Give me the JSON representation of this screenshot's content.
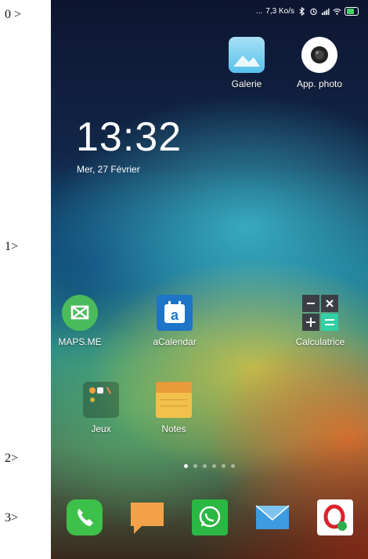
{
  "margin_labels": [
    "0 >",
    "1>",
    "2>",
    "3>"
  ],
  "status": {
    "speed": "7,3 Ko/s",
    "menu": "..."
  },
  "lockscreen": {
    "time": "13:32",
    "date": "Mer, 27 Février"
  },
  "apps": {
    "galerie": "Galerie",
    "camera": "App. photo",
    "maps": "MAPS.ME",
    "acalendar": "aCalendar",
    "calculatrice": "Calculatrice",
    "jeux": "Jeux",
    "notes": "Notes"
  },
  "dock": [
    "phone-icon",
    "messages-icon",
    "whatsapp-icon",
    "email-icon",
    "opera-icon"
  ],
  "pager": {
    "pages": 6,
    "active": 1
  },
  "colors": {
    "maps": "#4cbb5c",
    "acalendar": "#1e74c6",
    "calc": "#3b3f45",
    "notes": "#f2c14b",
    "phone": "#3ec14a",
    "message": "#f4a24a",
    "whatsapp": "#2bb743",
    "mail": "#3d9be0",
    "opera": "#d8232a"
  }
}
